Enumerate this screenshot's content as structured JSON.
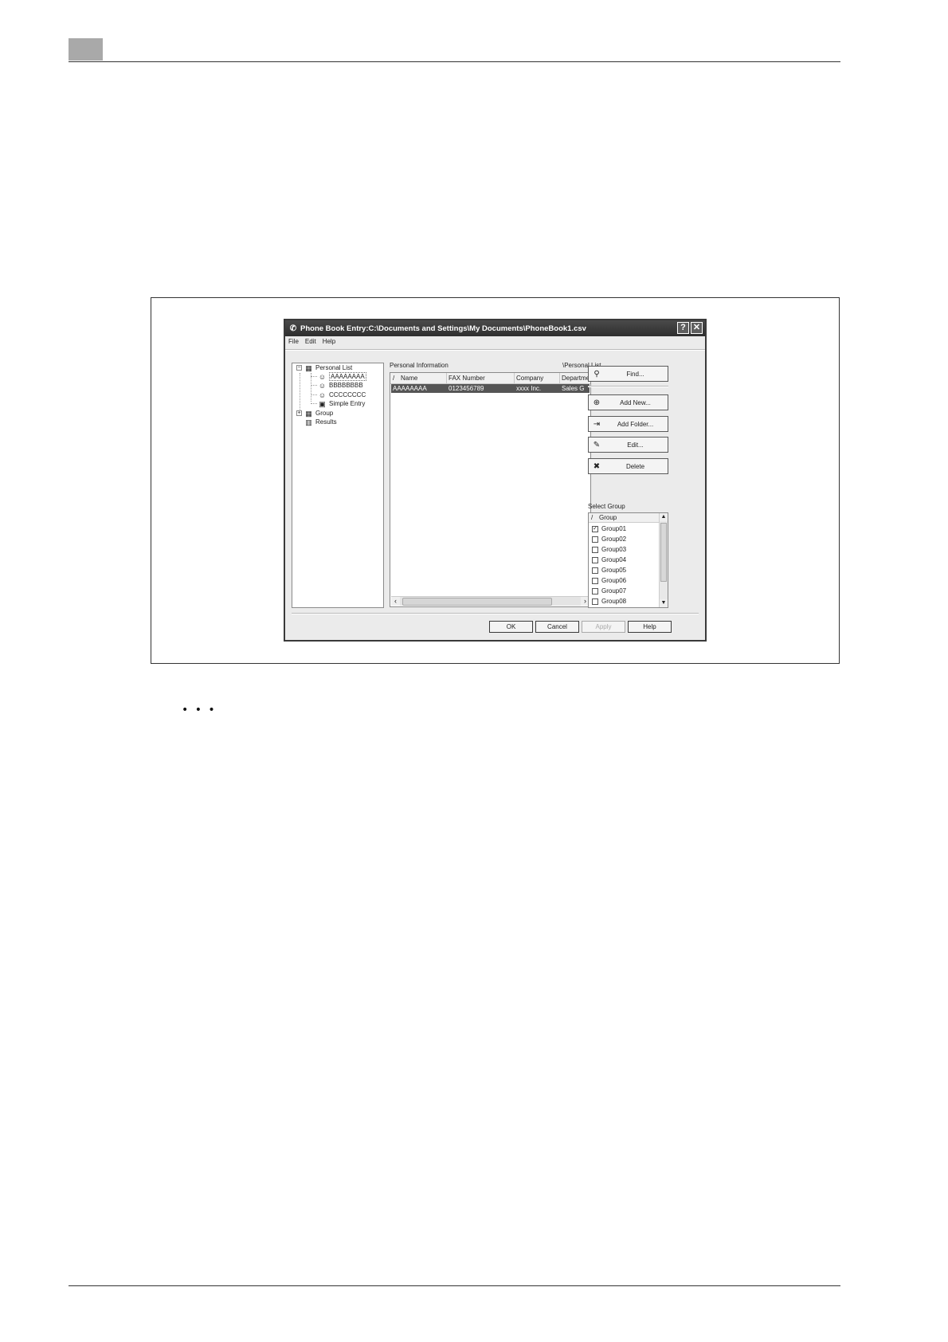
{
  "dialog": {
    "title": "Phone Book Entry:C:\\Documents and Settings\\My Documents\\PhoneBook1.csv",
    "help_glyph": "?",
    "close_glyph": "✕"
  },
  "menu": {
    "file": "File",
    "edit": "Edit",
    "help": "Help"
  },
  "tree": {
    "personal_list": "Personal List",
    "entries": [
      "AAAAAAAA",
      "BBBBBBBB",
      "CCCCCCCC"
    ],
    "simple_entry": "Simple Entry",
    "group": "Group",
    "results": "Results"
  },
  "info": {
    "label": "Personal Information",
    "path": "\\Personal List",
    "columns": [
      "/",
      "Name",
      "FAX Number",
      "Company",
      "Departmer"
    ],
    "rows": [
      {
        "name": "AAAAAAAA",
        "fax": "0123456789",
        "company": "xxxx Inc.",
        "department": "Sales G"
      }
    ]
  },
  "buttons": {
    "find": "Find...",
    "add_new": "Add New...",
    "add_folder": "Add Folder...",
    "edit": "Edit...",
    "delete": "Delete"
  },
  "select_group": {
    "label": "Select Group",
    "header_sort": "/",
    "header": "Group",
    "groups": [
      {
        "name": "Group01",
        "checked": true
      },
      {
        "name": "Group02",
        "checked": false
      },
      {
        "name": "Group03",
        "checked": false
      },
      {
        "name": "Group04",
        "checked": false
      },
      {
        "name": "Group05",
        "checked": false
      },
      {
        "name": "Group06",
        "checked": false
      },
      {
        "name": "Group07",
        "checked": false
      },
      {
        "name": "Group08",
        "checked": false
      }
    ]
  },
  "footer_buttons": {
    "ok": "OK",
    "cancel": "Cancel",
    "apply": "Apply",
    "help": "Help"
  },
  "note_marker": "• • •"
}
